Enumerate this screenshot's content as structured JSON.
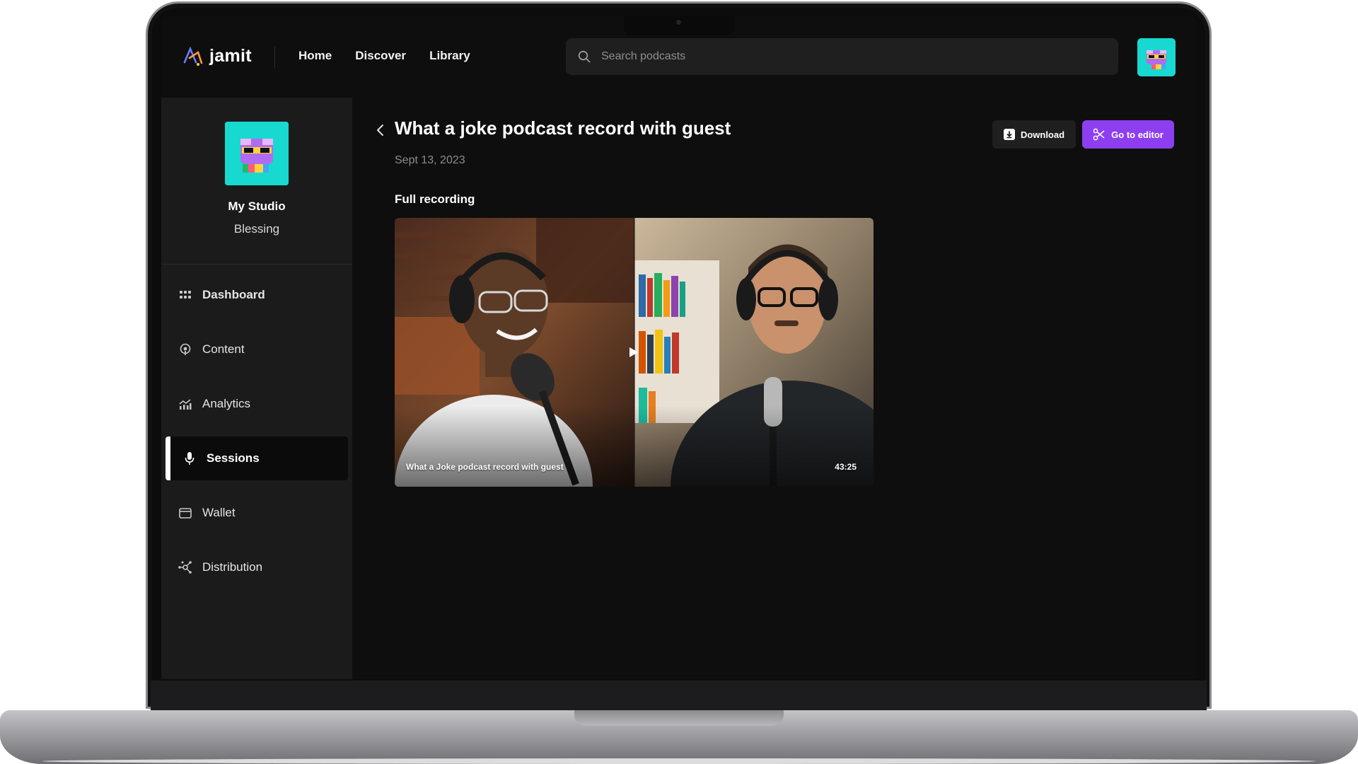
{
  "app": {
    "brand": "jamit"
  },
  "nav": {
    "items": [
      {
        "label": "Home"
      },
      {
        "label": "Discover"
      },
      {
        "label": "Library"
      }
    ]
  },
  "search": {
    "placeholder": "Search podcasts",
    "value": ""
  },
  "studio": {
    "name": "My Studio",
    "user": "Blessing"
  },
  "sidebar": {
    "items": [
      {
        "label": "Dashboard",
        "icon": "grid-icon",
        "active": false
      },
      {
        "label": "Content",
        "icon": "podcast-icon",
        "active": false
      },
      {
        "label": "Analytics",
        "icon": "chart-icon",
        "active": false
      },
      {
        "label": "Sessions",
        "icon": "microphone-icon",
        "active": true
      },
      {
        "label": "Wallet",
        "icon": "wallet-icon",
        "active": false
      },
      {
        "label": "Distribution",
        "icon": "network-icon",
        "active": false
      }
    ]
  },
  "page": {
    "title": "What a joke podcast record with guest",
    "date": "Sept 13, 2023",
    "section_label": "Full recording"
  },
  "actions": {
    "download_label": "Download",
    "editor_label": "Go to editor"
  },
  "video": {
    "caption": "What a Joke podcast record with guest",
    "duration": "43:25"
  },
  "colors": {
    "accent": "#8d3ff0",
    "avatar_bg": "#17d9cf",
    "background": "#0e0e0e",
    "sidebar": "#1b1b1b"
  }
}
